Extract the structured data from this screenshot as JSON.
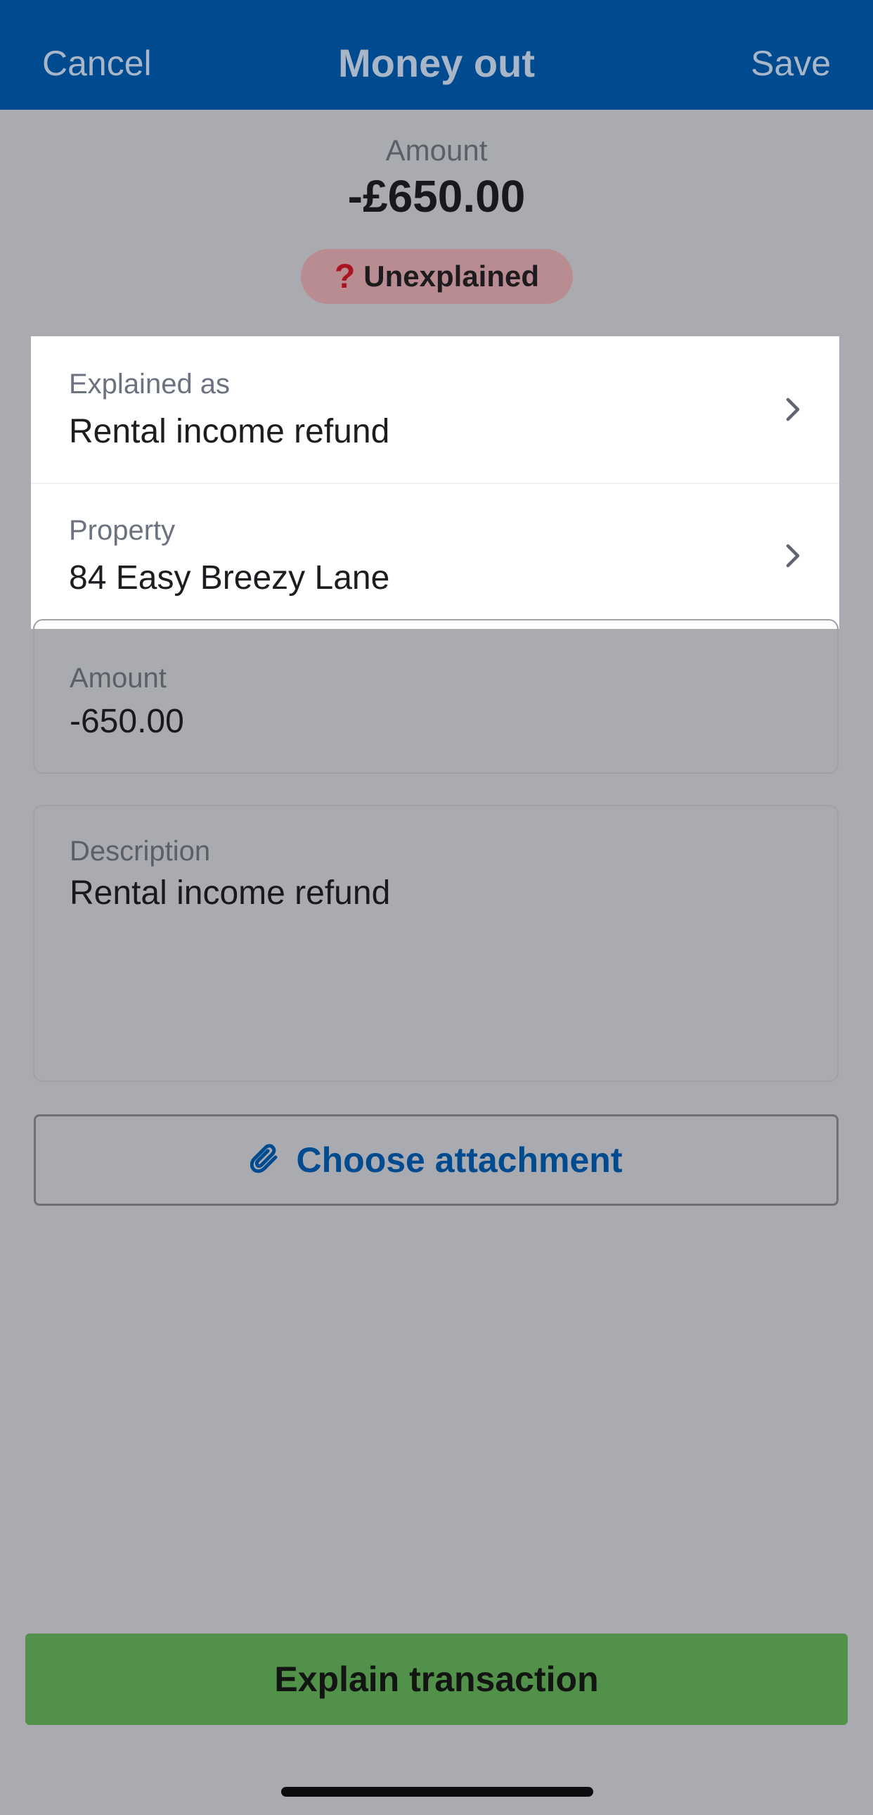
{
  "header": {
    "cancel_label": "Cancel",
    "title": "Money out",
    "save_label": "Save"
  },
  "summary": {
    "amount_label": "Amount",
    "amount_value": "-£650.00",
    "status_icon": "question-mark-icon",
    "status_text": "Unexplained"
  },
  "details": {
    "explained_as": {
      "label": "Explained as",
      "value": "Rental income refund"
    },
    "property": {
      "label": "Property",
      "value": "84 Easy Breezy Lane"
    }
  },
  "amount_field": {
    "label": "Amount",
    "value": "-650.00"
  },
  "description_field": {
    "label": "Description",
    "value": "Rental income refund"
  },
  "attachment": {
    "icon": "paperclip-icon",
    "label": "Choose attachment"
  },
  "primary_action": {
    "label": "Explain transaction"
  },
  "colors": {
    "nav_background": "#004a8f",
    "accent_blue": "#004a8f",
    "primary_green": "#52914a",
    "badge_background": "#b98c92",
    "overlay_background": "#aaabb0"
  }
}
